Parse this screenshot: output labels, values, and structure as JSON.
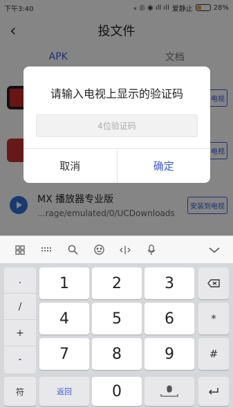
{
  "status_bar": {
    "time": "下午3:40",
    "icons": "⁎ ◎ ◉ ıll ıll",
    "carrier": "爱静止",
    "battery": "28%"
  },
  "title_bar": {
    "back_icon": "back-chevron-icon",
    "title": "投文件"
  },
  "tabs": [
    {
      "label": "APK",
      "active": true
    },
    {
      "label": "文档",
      "active": false
    }
  ],
  "list_items": [
    {
      "icon": "video-app-icon",
      "title": "",
      "path": "",
      "action": "电视"
    },
    {
      "icon": "media-app-icon",
      "title": "",
      "path": "",
      "action": "电视"
    },
    {
      "icon": "play-icon",
      "title": "MX 播放器专业版",
      "path": "...rage/emulated/0/UCDownloads",
      "action": "安装到电视"
    }
  ],
  "dialog": {
    "title": "请输入电视上显示的验证码",
    "input": {
      "placeholder": "4位验证码",
      "value": ""
    },
    "cancel_label": "取消",
    "confirm_label": "确定"
  },
  "keyboard": {
    "toolbar_icons": [
      "grid-icon",
      "keyboard-icon",
      "search-icon",
      "emoji-icon",
      "cursor-icon",
      "microphone-icon",
      "hide-keyboard-icon"
    ],
    "symbols": [
      ".",
      "/",
      "+",
      "-"
    ],
    "digits": [
      "1",
      "2",
      "3",
      "4",
      "5",
      "6",
      "7",
      "8",
      "9",
      "0"
    ],
    "backspace_icon": "backspace-icon",
    "asterisk": "*",
    "hash": "#",
    "fu_label": "符",
    "back_label": "返回",
    "space_icon": "space-mic-icon",
    "enter_icon": "enter-icon"
  },
  "colors": {
    "accent": "#3a5bd8",
    "battery": "#e8a23b"
  }
}
